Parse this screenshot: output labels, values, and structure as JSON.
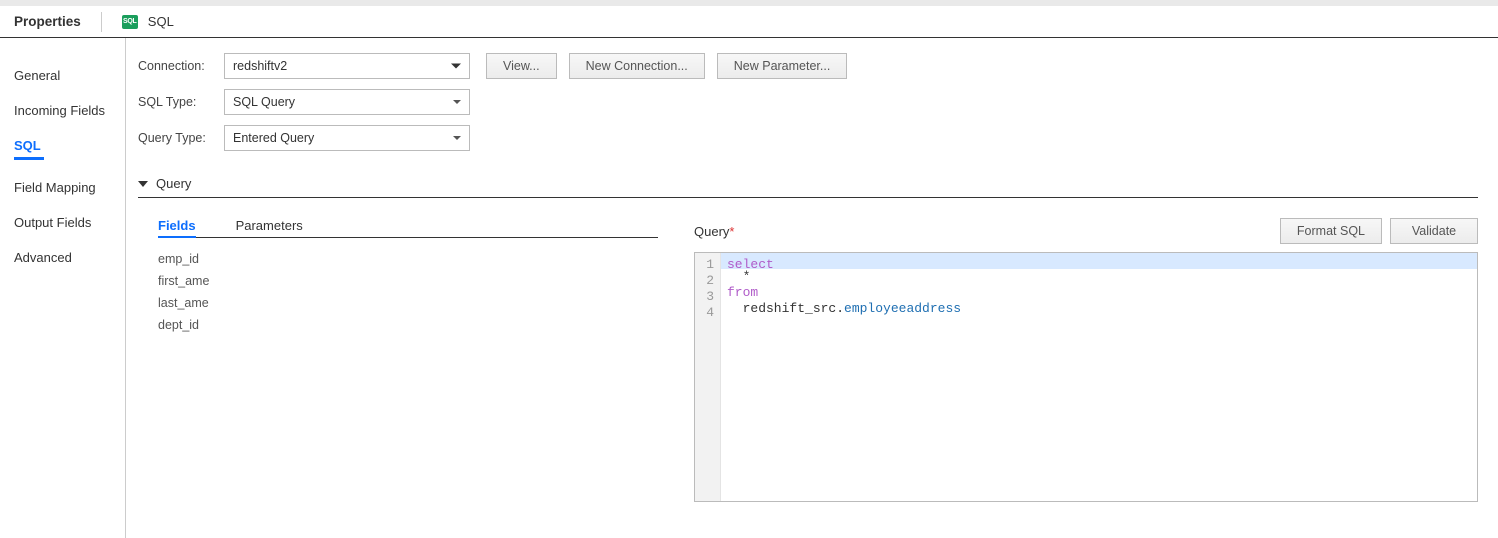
{
  "topbar": {
    "title": "Properties",
    "icon_name": "sql-icon",
    "icon_text": "SQL",
    "sql_label": "SQL"
  },
  "side_tabs": [
    {
      "label": "General",
      "active": false
    },
    {
      "label": "Incoming Fields",
      "active": false
    },
    {
      "label": "SQL",
      "active": true
    },
    {
      "label": "Field Mapping",
      "active": false
    },
    {
      "label": "Output Fields",
      "active": false
    },
    {
      "label": "Advanced",
      "active": false
    }
  ],
  "form": {
    "connection_label": "Connection:",
    "connection_value": "redshiftv2",
    "view_btn": "View...",
    "new_conn_btn": "New Connection...",
    "new_param_btn": "New Parameter...",
    "sql_type_label": "SQL Type:",
    "sql_type_value": "SQL Query",
    "query_type_label": "Query Type:",
    "query_type_value": "Entered Query"
  },
  "section": {
    "query_label": "Query"
  },
  "fields_panel": {
    "tabs": [
      {
        "label": "Fields",
        "active": true
      },
      {
        "label": "Parameters",
        "active": false
      }
    ],
    "fields": [
      "emp_id",
      "first_ame",
      "last_ame",
      "dept_id"
    ]
  },
  "query_panel": {
    "title": "Query",
    "required": "*",
    "format_btn": "Format SQL",
    "validate_btn": "Validate",
    "line_numbers": [
      "1",
      "2",
      "3",
      "4"
    ],
    "code_tokens": {
      "l1_kw": "select",
      "l2_star": "  *",
      "l3_kw": "from",
      "l4_prefix": "  redshift_src.",
      "l4_table": "employeeaddress"
    }
  }
}
